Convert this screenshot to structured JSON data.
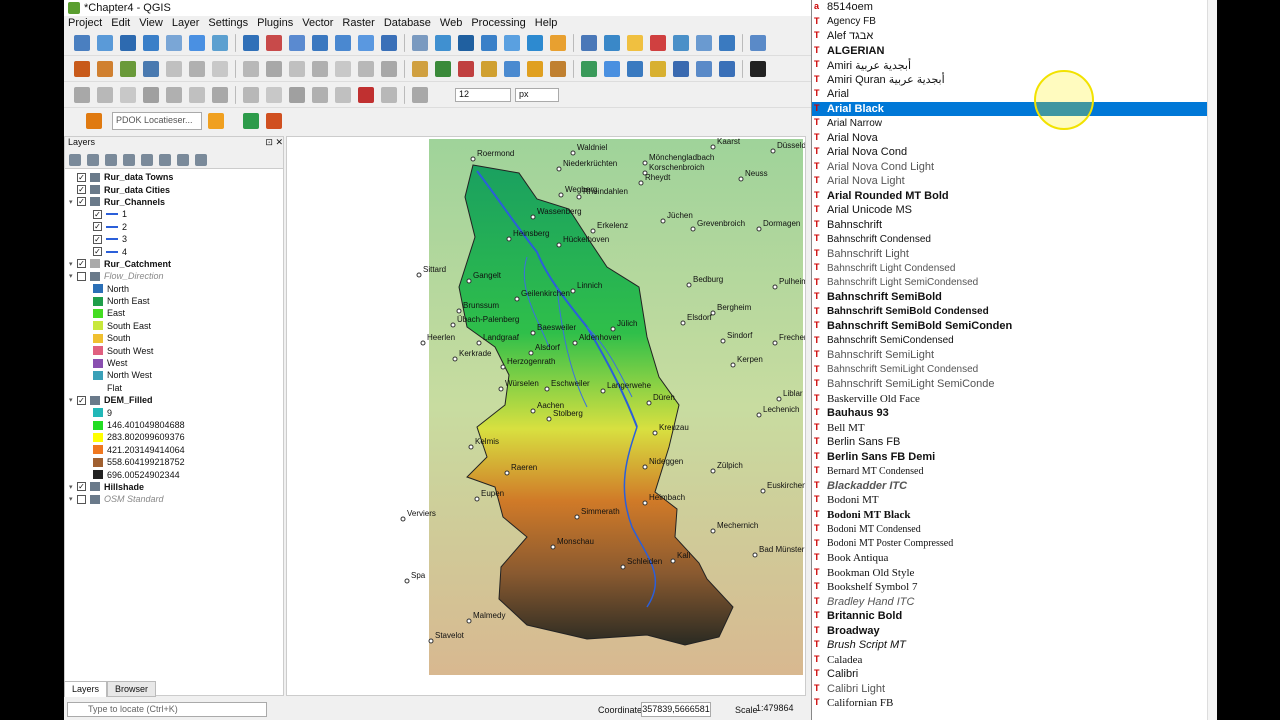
{
  "window": {
    "title": "*Chapter4 - QGIS"
  },
  "menu": [
    "Project",
    "Edit",
    "View",
    "Layer",
    "Settings",
    "Plugins",
    "Vector",
    "Raster",
    "Database",
    "Web",
    "Processing",
    "Help"
  ],
  "toolbar": {
    "font_size_value": "12",
    "font_unit": "px",
    "locator_placeholder": "PDOK Locatieser..."
  },
  "layers_panel": {
    "title": "Layers",
    "items": [
      {
        "label": "Rur_data Towns",
        "checked": true,
        "bold": true
      },
      {
        "label": "Rur_data Cities",
        "checked": true,
        "bold": true
      },
      {
        "label": "Rur_Channels",
        "checked": true,
        "bold": true
      },
      {
        "label": "1",
        "checked": true
      },
      {
        "label": "2",
        "checked": true
      },
      {
        "label": "3",
        "checked": true
      },
      {
        "label": "4",
        "checked": true
      },
      {
        "label": "Rur_Catchment",
        "checked": true,
        "bold": true
      },
      {
        "label": "Flow_Direction",
        "checked": false,
        "italic": true
      },
      {
        "label": "North"
      },
      {
        "label": "North East"
      },
      {
        "label": "East"
      },
      {
        "label": "South East"
      },
      {
        "label": "South"
      },
      {
        "label": "South West"
      },
      {
        "label": "West"
      },
      {
        "label": "North West"
      },
      {
        "label": "Flat"
      },
      {
        "label": "DEM_Filled",
        "checked": true,
        "bold": true
      },
      {
        "label": "9"
      },
      {
        "label": "146.401049804688"
      },
      {
        "label": "283.802099609376"
      },
      {
        "label": "421.203149414064"
      },
      {
        "label": "558.604199218752"
      },
      {
        "label": "696.00524902344"
      },
      {
        "label": "Hillshade",
        "checked": true,
        "bold": true
      },
      {
        "label": "OSM Standard",
        "checked": false,
        "italic": true
      }
    ],
    "colors": {
      "North": "#2b6fb6",
      "North East": "#1f9e4a",
      "East": "#44dd22",
      "South East": "#c8e83c",
      "South": "#f0c030",
      "South West": "#e06080",
      "West": "#8a4fb0",
      "North West": "#3aa0b8",
      "dem_9": "#22b8b8",
      "dem_146": "#22dd22",
      "dem_283": "#ffff00",
      "dem_421": "#f07820",
      "dem_558": "#a06030",
      "dem_696": "#222222"
    }
  },
  "tabs": [
    "Layers",
    "Browser"
  ],
  "status": {
    "search_placeholder": "Type to locate (Ctrl+K)",
    "coordinate_label": "Coordinate",
    "coordinate_value": "357839,5666581",
    "scale_label": "Scale",
    "scale_value": "1:479864"
  },
  "map_labels": [
    "Roermond",
    "Waldniel",
    "Mönchengladbach",
    "Kaarst",
    "Düsseld",
    "Niederkrüchten",
    "Korschenbroich",
    "Neuss",
    "Rheydt",
    "Wegberg",
    "Rheindahlen",
    "Wassenberg",
    "Erkelenz",
    "Jüchen",
    "Heinsberg",
    "Hückelhoven",
    "Grevenbroich",
    "Dormagen",
    "Sittard",
    "Gangelt",
    "Geilenkirchen",
    "Linnich",
    "Bedburg",
    "Pulheim",
    "Brunssum",
    "Übach-Palenberg",
    "Bergheim",
    "Elsdorf",
    "Jülich",
    "Baesweiler",
    "Heerlen",
    "Landgraaf",
    "Alsdorf",
    "Aldenhoven",
    "Sindorf",
    "Frechen",
    "Kerkrade",
    "Herzogenrath",
    "Kerpen",
    "Würselen",
    "Eschweiler",
    "Langerwehe",
    "Liblar",
    "Aachen",
    "Düren",
    "Lechenich",
    "Stolberg",
    "Kreuzau",
    "Kelmis",
    "Nideggen",
    "Zülpich",
    "Raeren",
    "Eupen",
    "Heimbach",
    "Euskirchen",
    "Verviers",
    "Simmerath",
    "Mechernich",
    "Monschau",
    "Schleiden",
    "Kall",
    "Bad Münster",
    "Spa",
    "Malmedy",
    "Stavelot"
  ],
  "font_list": {
    "selected": "Arial Black",
    "items": [
      "8514oem",
      "Agency FB",
      "Alef אבגד",
      "ALGERIAN",
      "Amiri أبجدية عربية",
      "Amiri Quran أبجدية عربية",
      "Arial",
      "Arial Black",
      "Arial Narrow",
      "Arial Nova",
      "Arial Nova Cond",
      "Arial Nova Cond Light",
      "Arial Nova Light",
      "Arial Rounded MT Bold",
      "Arial Unicode MS",
      "Bahnschrift",
      "Bahnschrift Condensed",
      "Bahnschrift Light",
      "Bahnschrift Light Condensed",
      "Bahnschrift Light SemiCondensed",
      "Bahnschrift SemiBold",
      "Bahnschrift SemiBold Condensed",
      "Bahnschrift SemiBold SemiConden",
      "Bahnschrift SemiCondensed",
      "Bahnschrift SemiLight",
      "Bahnschrift SemiLight Condensed",
      "Bahnschrift SemiLight SemiConde",
      "Baskerville Old Face",
      "Bauhaus 93",
      "Bell MT",
      "Berlin Sans FB",
      "Berlin Sans FB Demi",
      "Bernard MT Condensed",
      "Blackadder ITC",
      "Bodoni MT",
      "Bodoni MT Black",
      "Bodoni MT Condensed",
      "Bodoni MT Poster Compressed",
      "Book Antiqua",
      "Bookman Old Style",
      "Bookshelf Symbol 7",
      "Bradley Hand ITC",
      "Britannic Bold",
      "Broadway",
      "Brush Script MT",
      "Caladea",
      "Calibri",
      "Calibri Light",
      "Californian FB"
    ]
  }
}
